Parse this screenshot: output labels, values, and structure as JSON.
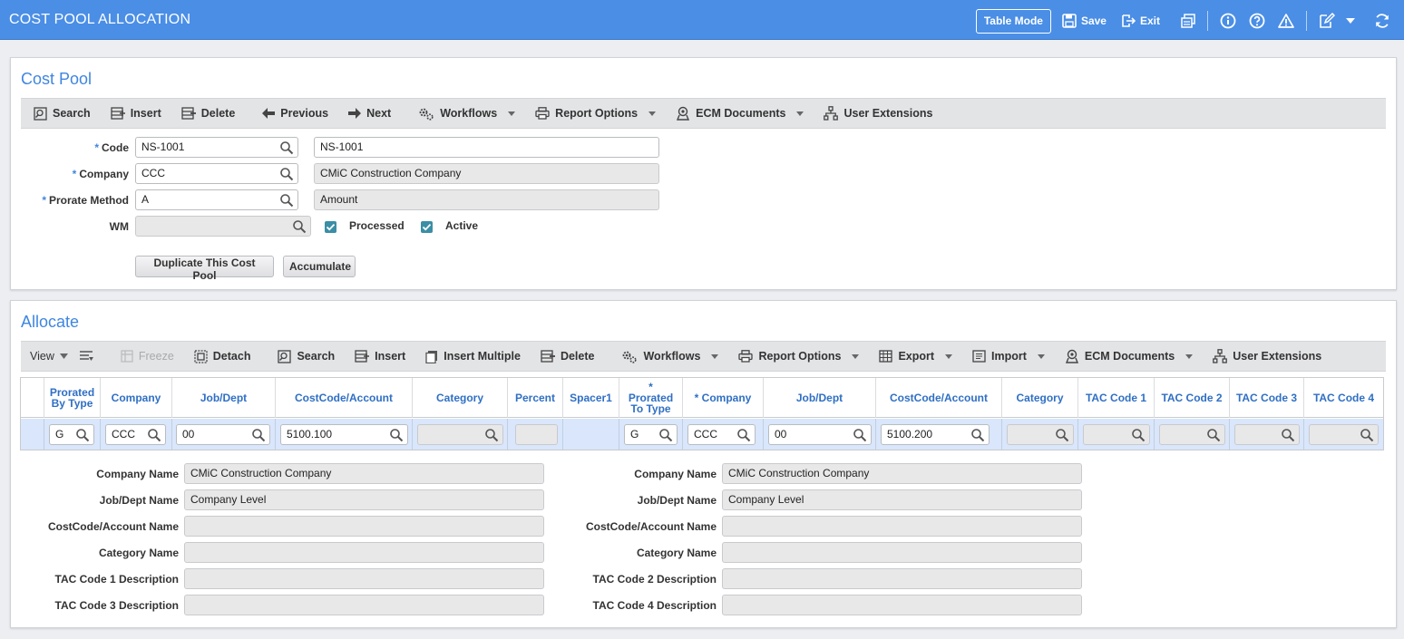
{
  "app": {
    "title": "COST POOL ALLOCATION",
    "table_mode_label": "Table Mode",
    "save_label": "Save",
    "exit_label": "Exit"
  },
  "cost_pool": {
    "title": "Cost Pool",
    "toolbar": {
      "search": "Search",
      "insert": "Insert",
      "delete": "Delete",
      "previous": "Previous",
      "next": "Next",
      "workflows": "Workflows",
      "report_options": "Report Options",
      "ecm_documents": "ECM Documents",
      "user_extensions": "User Extensions"
    },
    "fields": {
      "code_label": "Code",
      "code_value": "NS-1001",
      "code_desc": "NS-1001",
      "company_label": "Company",
      "company_value": "CCC",
      "company_desc": "CMiC Construction Company",
      "prorate_label": "Prorate Method",
      "prorate_value": "A",
      "prorate_desc": "Amount",
      "wm_label": "WM",
      "wm_value": "",
      "processed_label": "Processed",
      "processed_checked": true,
      "active_label": "Active",
      "active_checked": true
    },
    "buttons": {
      "duplicate": "Duplicate This Cost Pool",
      "accumulate": "Accumulate"
    }
  },
  "allocate": {
    "title": "Allocate",
    "toolbar": {
      "view": "View",
      "freeze": "Freeze",
      "detach": "Detach",
      "search": "Search",
      "insert": "Insert",
      "insert_multiple": "Insert Multiple",
      "delete": "Delete",
      "workflows": "Workflows",
      "report_options": "Report Options",
      "export": "Export",
      "import": "Import",
      "ecm_documents": "ECM Documents",
      "user_extensions": "User Extensions"
    },
    "columns": [
      "Prorated By Type",
      "Company",
      "Job/Dept",
      "CostCode/Account",
      "Category",
      "Percent",
      "Spacer1",
      "* Prorated To Type",
      "* Company",
      "Job/Dept",
      "CostCode/Account",
      "Category",
      "TAC Code 1",
      "TAC Code 2",
      "TAC Code 3",
      "TAC Code 4"
    ],
    "row": {
      "by_type": "G",
      "company": "CCC",
      "job_dept": "00",
      "costcode": "5100.100",
      "category": "",
      "percent": "",
      "to_type": "G",
      "to_company": "CCC",
      "to_job_dept": "00",
      "to_costcode": "5100.200",
      "to_category": "",
      "tac1": "",
      "tac2": "",
      "tac3": "",
      "tac4": ""
    },
    "detail_left": {
      "company_name_label": "Company Name",
      "company_name": "CMiC Construction Company",
      "job_dept_name_label": "Job/Dept Name",
      "job_dept_name": "Company Level",
      "costcode_name_label": "CostCode/Account Name",
      "costcode_name": "",
      "category_name_label": "Category Name",
      "category_name": "",
      "tac1_label": "TAC Code 1 Description",
      "tac1": "",
      "tac3_label": "TAC Code 3 Description",
      "tac3": ""
    },
    "detail_right": {
      "company_name_label": "Company Name",
      "company_name": "CMiC Construction Company",
      "job_dept_name_label": "Job/Dept Name",
      "job_dept_name": "Company Level",
      "costcode_name_label": "CostCode/Account Name",
      "costcode_name": "",
      "category_name_label": "Category Name",
      "category_name": "",
      "tac2_label": "TAC Code 2 Description",
      "tac2": "",
      "tac4_label": "TAC Code 4 Description",
      "tac4": ""
    }
  },
  "colors": {
    "header_blue": "#4a8ee6",
    "title_blue": "#3f86e0",
    "checkbox_teal": "#3a8ea5",
    "row_highlight": "#d9e6fb"
  }
}
